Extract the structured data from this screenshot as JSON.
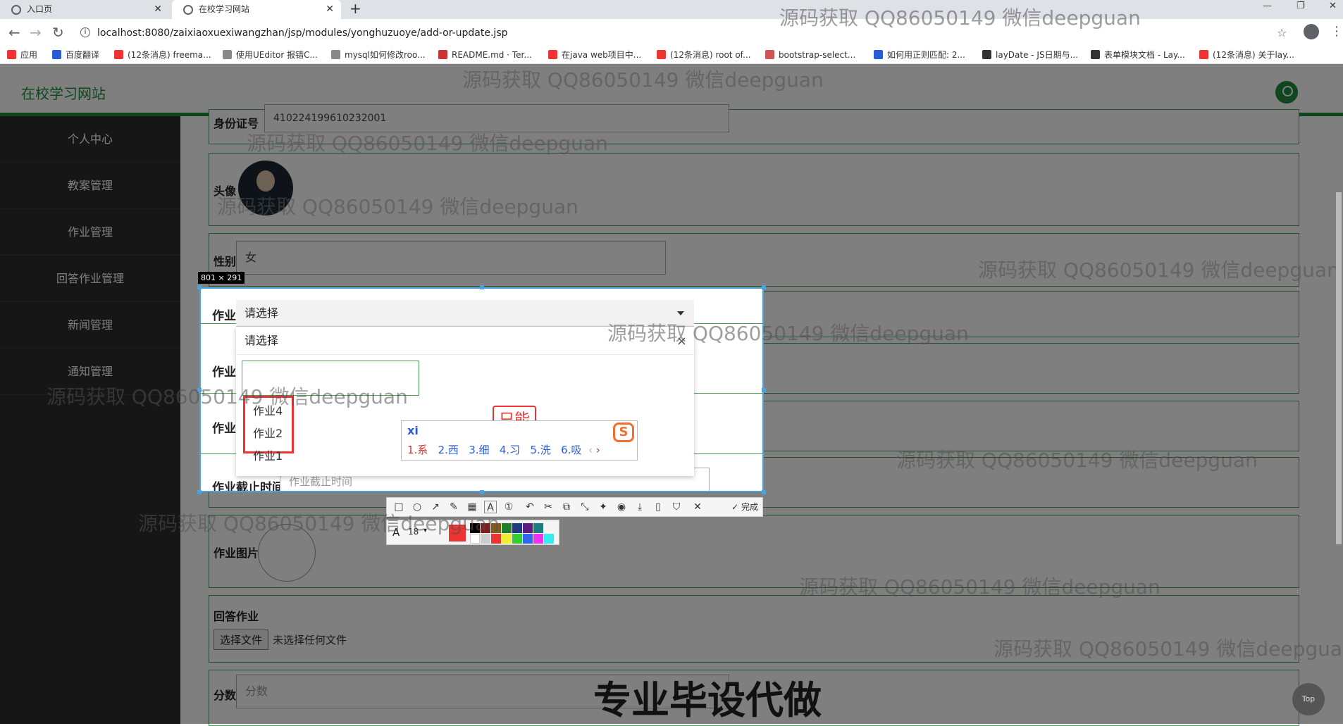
{
  "browser": {
    "tabs": [
      {
        "title": "入口页"
      },
      {
        "title": "在校学习网站"
      }
    ],
    "url": "localhost:8080/zaixiaoxuexiwangzhan/jsp/modules/yonghuzuoye/add-or-update.jsp",
    "bookmarks": [
      "应用",
      "百度翻译",
      "(12条消息) freema...",
      "使用UEditor 报错C...",
      "mysql如何修改roo...",
      "README.md · Ter...",
      "在java web项目中...",
      "(12条消息) root of...",
      "bootstrap-select...",
      "如何用正则匹配: 2...",
      "layDate - JS日期与...",
      "表单模块文档 - Lay...",
      "(12条消息) 关于lay..."
    ]
  },
  "site": {
    "title": "在校学习网站"
  },
  "sidebar": {
    "items": [
      "个人中心",
      "教案管理",
      "作业管理",
      "回答作业管理",
      "新闻管理",
      "通知管理"
    ]
  },
  "form": {
    "id_label": "身份证号",
    "id_value": "410224199610232001",
    "avatar_label": "头像",
    "gender_label": "性别",
    "gender_value": "女",
    "hw_label": "作业",
    "deadline_label": "作业截止时间",
    "deadline_placeholder": "作业截止时间",
    "image_label": "作业图片",
    "answer_label": "回答作业",
    "file_button": "选择文件",
    "file_status": "未选择任何文件",
    "score_label": "分数",
    "score_placeholder": "分数"
  },
  "dropdown": {
    "selected": "请选择",
    "first_option": "请选择",
    "options": [
      "作业4",
      "作业2",
      "作业1"
    ],
    "close": "×"
  },
  "stamp": {
    "text": "只能"
  },
  "ime": {
    "input": "xi",
    "candidates": [
      "1.系",
      "2.西",
      "3.细",
      "4.习",
      "5.洗",
      "6.吸"
    ],
    "logo": "S"
  },
  "capture": {
    "size": "801 × 291",
    "done": "完成",
    "font_size": "18"
  },
  "watermark": "源码获取 QQ86050149 微信deepguan",
  "banner": "专业毕设代做",
  "top_button": "Top",
  "colors": {
    "green": "#1e8c3c",
    "sidebar": "#2c2c2c",
    "selection": "#4aa3df",
    "red": "#e33333"
  }
}
